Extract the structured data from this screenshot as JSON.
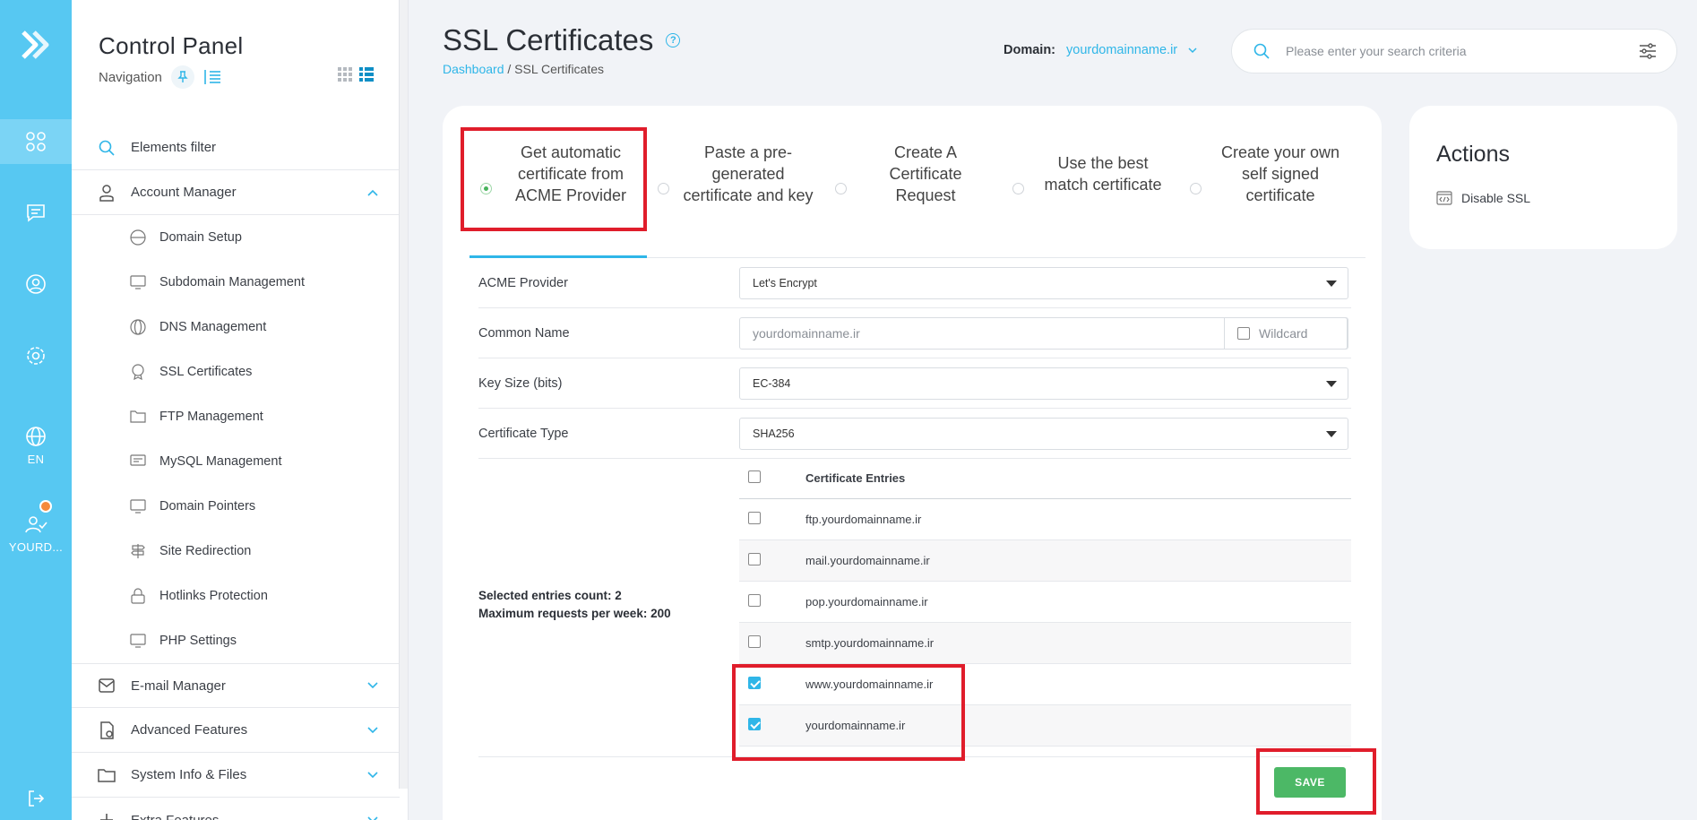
{
  "rail": {
    "lang": "EN",
    "user": "YOURD..."
  },
  "sidebar": {
    "title": "Control Panel",
    "subtitle": "Navigation",
    "filter": "Elements filter",
    "account_manager": "Account Manager",
    "children": [
      {
        "label": "Domain Setup",
        "icon": "www-icon"
      },
      {
        "label": "Subdomain Management",
        "icon": "monitor-icon"
      },
      {
        "label": "DNS Management",
        "icon": "globe-icon"
      },
      {
        "label": "SSL Certificates",
        "icon": "ssl-icon"
      },
      {
        "label": "FTP Management",
        "icon": "ftp-folder-icon"
      },
      {
        "label": "MySQL Management",
        "icon": "database-icon"
      },
      {
        "label": "Domain Pointers",
        "icon": "monitor-icon"
      },
      {
        "label": "Site Redirection",
        "icon": "signpost-icon"
      },
      {
        "label": "Hotlinks Protection",
        "icon": "lock-icon"
      },
      {
        "label": "PHP Settings",
        "icon": "php-icon"
      }
    ],
    "email_manager": "E-mail Manager",
    "advanced_features": "Advanced Features",
    "system_info": "System Info & Files",
    "extra_features": "Extra Features"
  },
  "header": {
    "title": "SSL Certificates",
    "breadcrumb_link": "Dashboard",
    "breadcrumb_current": " / SSL Certificates",
    "domain_label": "Domain:",
    "domain_value": "yourdomainname.ir",
    "search_placeholder": "Please enter your search criteria"
  },
  "tabs": [
    {
      "label": "Get automatic certificate from ACME Provider",
      "active": true
    },
    {
      "label": "Paste a pre-generated certificate and key",
      "active": false
    },
    {
      "label": "Create A Certificate Request",
      "active": false
    },
    {
      "label": "Use the best match certificate",
      "active": false
    },
    {
      "label": "Create your own self signed certificate",
      "active": false
    }
  ],
  "form": {
    "acme_label": "ACME Provider",
    "acme_value": "Let's Encrypt",
    "cn_label": "Common Name",
    "cn_placeholder": "yourdomainname.ir",
    "wildcard_label": "Wildcard",
    "keysize_label": "Key Size (bits)",
    "keysize_value": "EC-384",
    "certtype_label": "Certificate Type",
    "certtype_value": "SHA256",
    "selected_count": "Selected entries count: 2",
    "max_requests": "Maximum requests per week: 200",
    "entries_header": "Certificate Entries",
    "entries": [
      {
        "host": "ftp.yourdomainname.ir",
        "checked": false
      },
      {
        "host": "mail.yourdomainname.ir",
        "checked": false
      },
      {
        "host": "pop.yourdomainname.ir",
        "checked": false
      },
      {
        "host": "smtp.yourdomainname.ir",
        "checked": false
      },
      {
        "host": "www.yourdomainname.ir",
        "checked": true
      },
      {
        "host": "yourdomainname.ir",
        "checked": true
      }
    ],
    "save_label": "SAVE"
  },
  "actions": {
    "title": "Actions",
    "disable_ssl": "Disable SSL"
  },
  "colors": {
    "rail": "#57c8f2",
    "accent": "#2fb6e8",
    "save": "#4cb866",
    "highlight": "#e01d2b"
  }
}
